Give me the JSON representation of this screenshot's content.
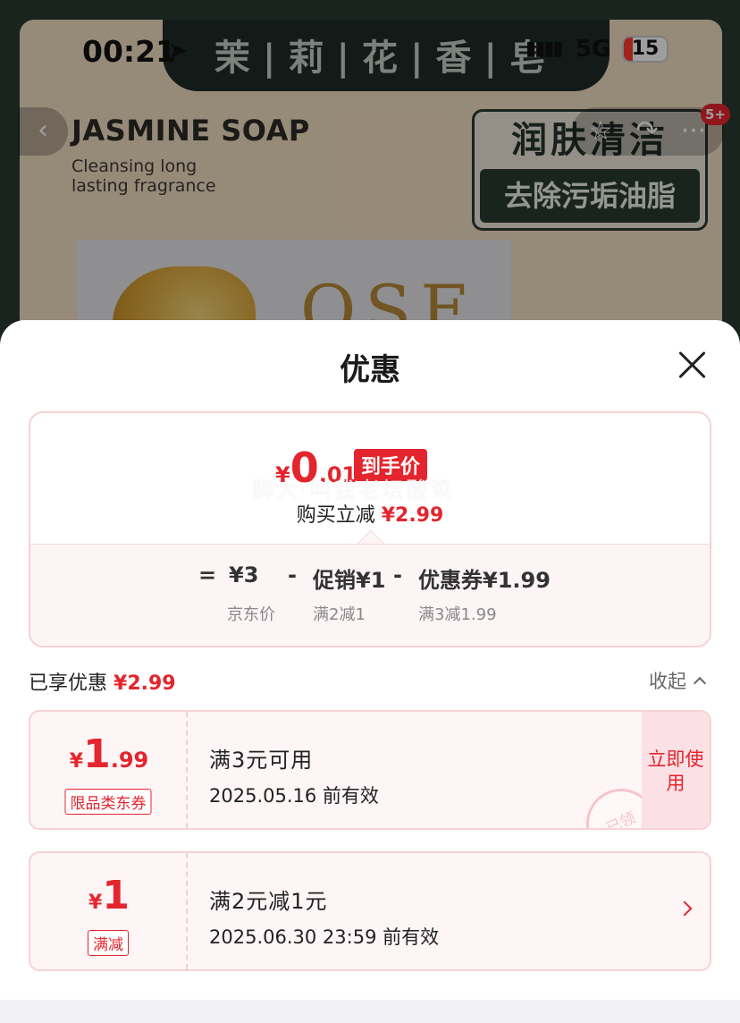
{
  "background": {
    "banner_title": "茉|莉|花|香|皂",
    "brand_en": "JASMINE SOAP",
    "brand_sub": "Cleansing long lasting fragrance",
    "feature_top": "润肤清洁",
    "feature_bottom": "去除污垢油脂",
    "product_text": "OSE"
  },
  "status_bar": {
    "time": "00:21",
    "network": "5G",
    "battery": "15"
  },
  "nav": {
    "badge": "5+"
  },
  "sheet": {
    "title": "优惠",
    "final_price": {
      "currency": "¥",
      "integer": "0",
      "decimal": ".01"
    },
    "final_price_tag": "到手价",
    "watermark": "脚大·叫我老坛酸菜",
    "instant_label": "购买立减",
    "instant_amount": "¥2.99",
    "calc": {
      "equals": "=",
      "jd_price": "¥3",
      "jd_label": "京东价",
      "minus1": "-",
      "promo": "促销¥1",
      "promo_sub": "满2减1",
      "minus2": "-",
      "coupon": "优惠券¥1.99",
      "coupon_sub": "满3减1.99"
    },
    "enjoyed_label": "已享优惠",
    "enjoyed_amount": "¥2.99",
    "collapse_label": "收起"
  },
  "coupons": [
    {
      "currency": "¥",
      "integer": "1",
      "decimal": ".99",
      "tag": "限品类东券",
      "title": "满3元可用",
      "date": "2025.05.16 前有效",
      "action": "立即使用",
      "stamp": "已领"
    },
    {
      "currency": "¥",
      "integer": "1",
      "decimal": "",
      "tag": "满减",
      "title": "满2元减1元",
      "date": "2025.06.30 23:59 前有效"
    }
  ]
}
